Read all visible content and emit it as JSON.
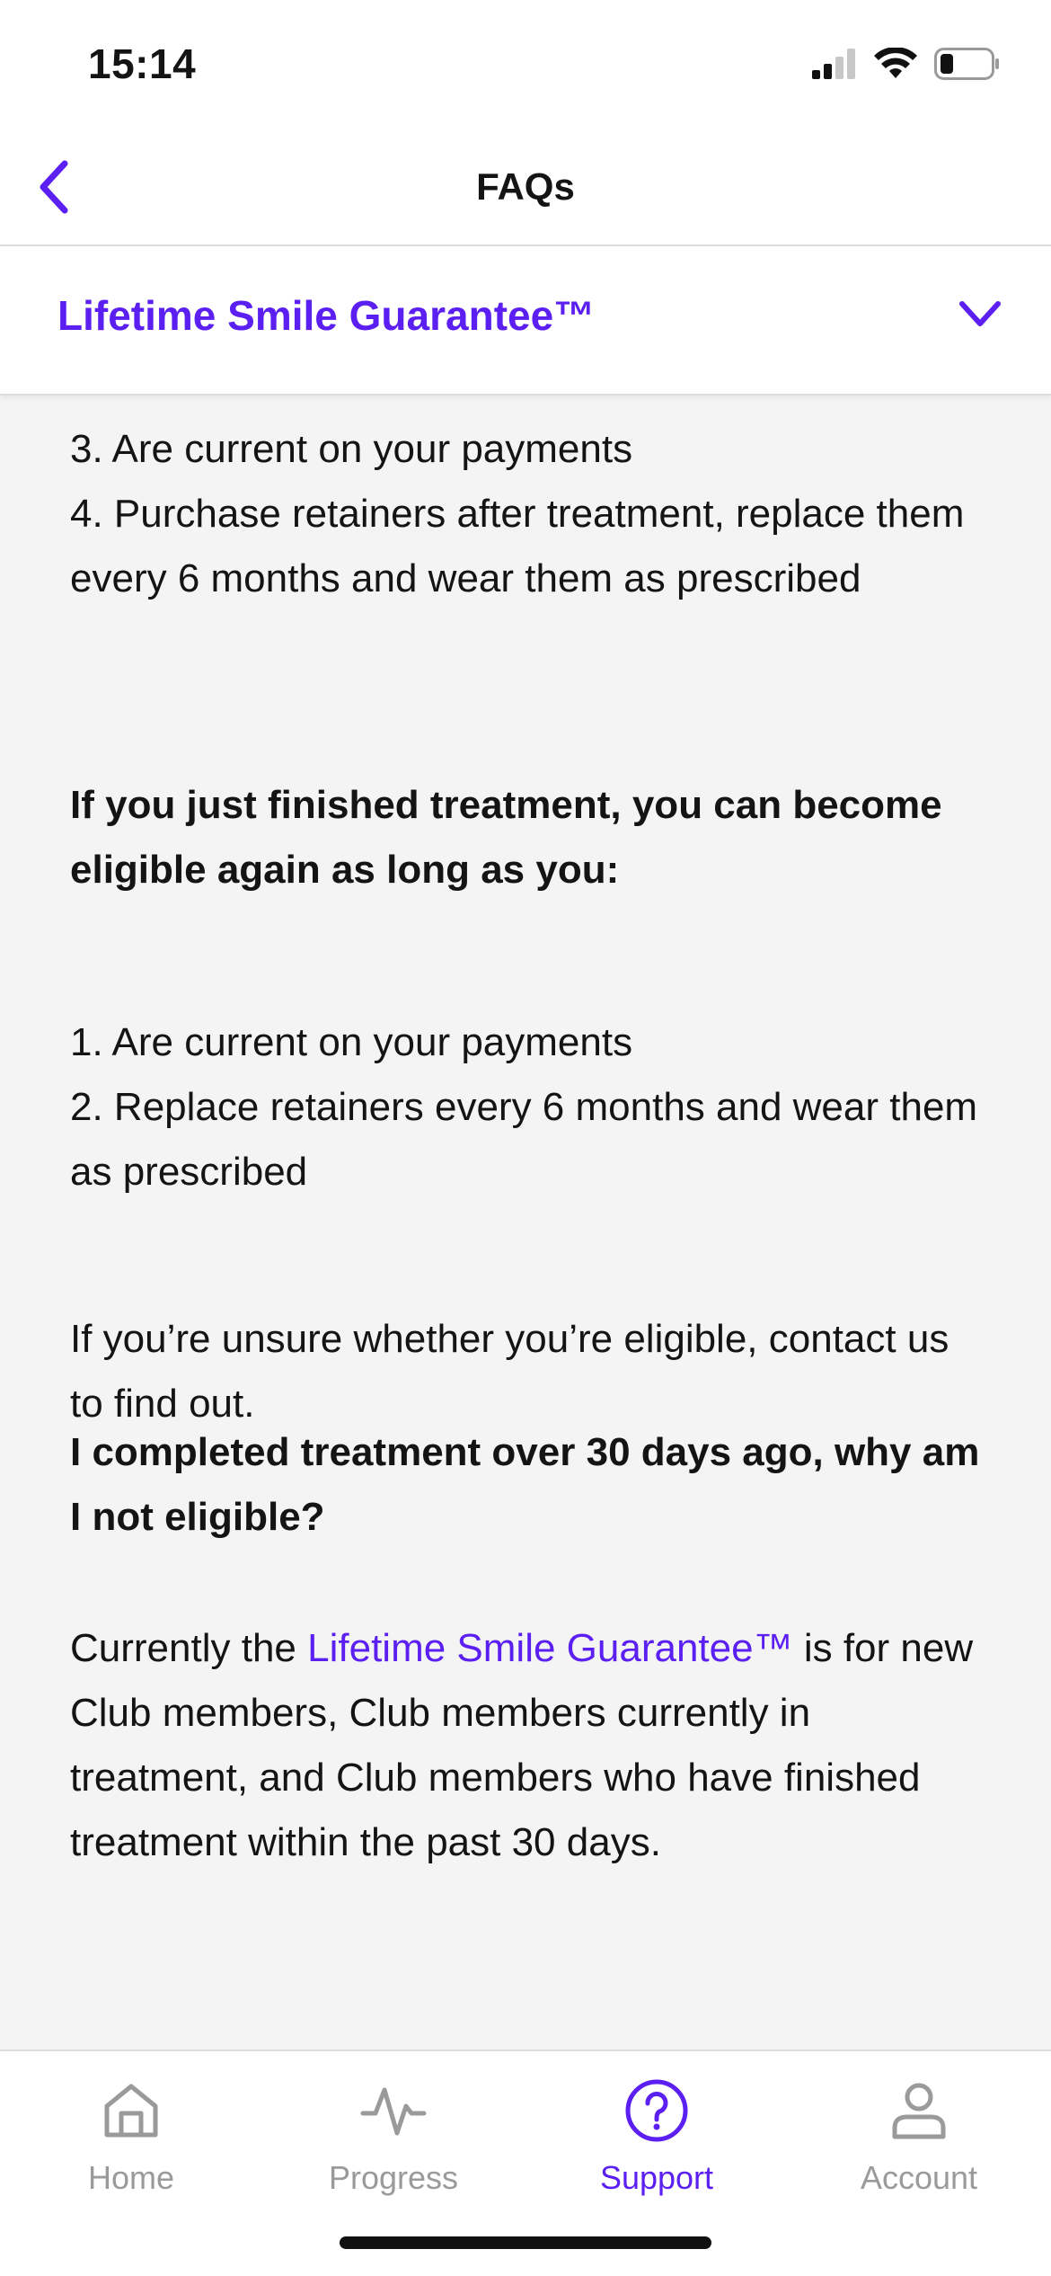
{
  "status_bar": {
    "time": "15:14"
  },
  "header": {
    "title": "FAQs"
  },
  "section": {
    "title": "Lifetime Smile Guarantee™"
  },
  "content": {
    "line_3": "3. Are current on your payments",
    "line_4": "4. Purchase retainers after treatment, replace them every 6 months and wear them as prescribed",
    "finished_heading": "If you just finished treatment, you can become eligible again as long as you:",
    "finished_item_1": "1. Are current on your payments",
    "finished_item_2": "2. Replace retainers every 6 months and wear them as prescribed",
    "unsure_text": "If you’re unsure whether you’re eligible, contact us to find out.",
    "question": "I completed treatment over 30 days ago, why am I not eligible?",
    "answer_prefix": "Currently the",
    "answer_link": "Lifetime Smile Guarantee™",
    "answer_suffix": "is for new Club members, Club members currently in treatment, and Club members who have finished treatment within the past 30 days."
  },
  "tabs": [
    {
      "label": "Home",
      "icon": "home-icon",
      "active": false
    },
    {
      "label": "Progress",
      "icon": "pulse-icon",
      "active": false
    },
    {
      "label": "Support",
      "icon": "question-circle-icon",
      "active": true
    },
    {
      "label": "Account",
      "icon": "person-icon",
      "active": false
    }
  ],
  "colors": {
    "accent": "#5b1ff2",
    "background": "#f4f4f4",
    "inactive": "#9a9a9a"
  }
}
